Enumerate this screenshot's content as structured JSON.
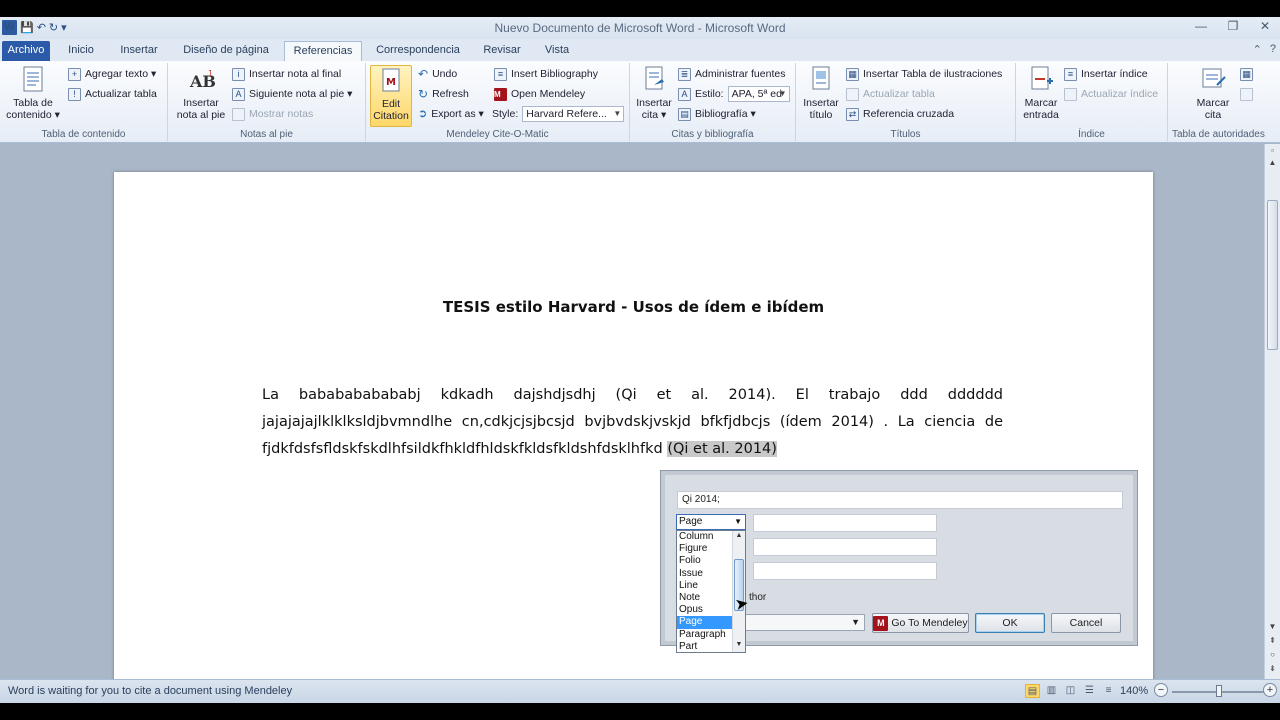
{
  "window": {
    "title": "Nuevo Documento de Microsoft Word  -  Microsoft Word",
    "qat": {
      "logo": "W",
      "save": "💾",
      "undo": "↶",
      "redo": "↻",
      "customize": "▾"
    }
  },
  "tabs": [
    {
      "label": "Archivo"
    },
    {
      "label": "Inicio"
    },
    {
      "label": "Insertar"
    },
    {
      "label": "Diseño de página"
    },
    {
      "label": "Referencias"
    },
    {
      "label": "Correspondencia"
    },
    {
      "label": "Revisar"
    },
    {
      "label": "Vista"
    }
  ],
  "ribbon": {
    "toc": {
      "group_label": "Tabla de contenido",
      "big_label": "Tabla de contenido ▾",
      "add_text": "Agregar texto ▾",
      "update_table": "Actualizar tabla"
    },
    "footnotes": {
      "group_label": "Notas al pie",
      "big_label": "Insertar nota al pie",
      "insert_endnote": "Insertar nota al final",
      "next_footnote": "Siguiente nota al pie ▾",
      "show_notes": "Mostrar notas"
    },
    "mendeley": {
      "group_label": "Mendeley Cite-O-Matic",
      "edit_citation": "Edit Citation",
      "undo": "Undo",
      "refresh": "Refresh",
      "export_as": "Export as ▾",
      "insert_bibliography": "Insert Bibliography",
      "open_mendeley": "Open Mendeley",
      "style_label": "Style:",
      "style_value": "Harvard Refere..."
    },
    "citations": {
      "group_label": "Citas y bibliografía",
      "big_label": "Insertar cita ▾",
      "manage_sources": "Administrar fuentes",
      "style_label": "Estilo:",
      "style_value": "APA, 5ª ed",
      "bibliography": "Bibliografía ▾"
    },
    "captions": {
      "group_label": "Títulos",
      "big_label": "Insertar título",
      "insert_table_of_figures": "Insertar Tabla de ilustraciones",
      "update_table": "Actualizar tabla",
      "cross_reference": "Referencia cruzada"
    },
    "index": {
      "group_label": "Índice",
      "big_label": "Marcar entrada",
      "insert_index": "Insertar índice",
      "update_index": "Actualizar índice"
    },
    "authorities": {
      "group_label": "Tabla de autoridades",
      "big_label": "Marcar cita"
    }
  },
  "document": {
    "title": "TESIS    estilo Harvard  - Usos de ídem e ibídem",
    "lines": [
      "La bababababababj kdkadh dajshdjsdhj (Qi et al. 2014). El trabajo ddd dddddd",
      "jajajajajlklklksldjbvmndlhe cn,cdkjcjsjbcsjd bvjbvdskjvskjd bfkfjdbcjs (ídem 2014) . La ciencia de"
    ],
    "last_line_text": "fjdkfdsfsfldskfskdlhfsildkfhkldfhldskfkldsfkldshfdsklhfkd ",
    "highlighted_citation": "(Qi et al. 2014)"
  },
  "dialog": {
    "citation_text": "Qi 2014;",
    "locator_selected": "Page",
    "locator_options": [
      "Column",
      "Figure",
      "Folio",
      "Issue",
      "Line",
      "Note",
      "Opus",
      "Page",
      "Paragraph",
      "Part"
    ],
    "author_label_visible": "thor",
    "go_to_mendeley": "Go To Mendeley",
    "ok": "OK",
    "cancel": "Cancel"
  },
  "status": {
    "message": "Word is waiting for you to cite a document using Mendeley",
    "zoom": "140%"
  },
  "colors": {
    "file_tab": "#2a5aa8",
    "selection": "#3399ff",
    "mendeley_red": "#a4121b",
    "highlight": "#c8c8c8"
  }
}
